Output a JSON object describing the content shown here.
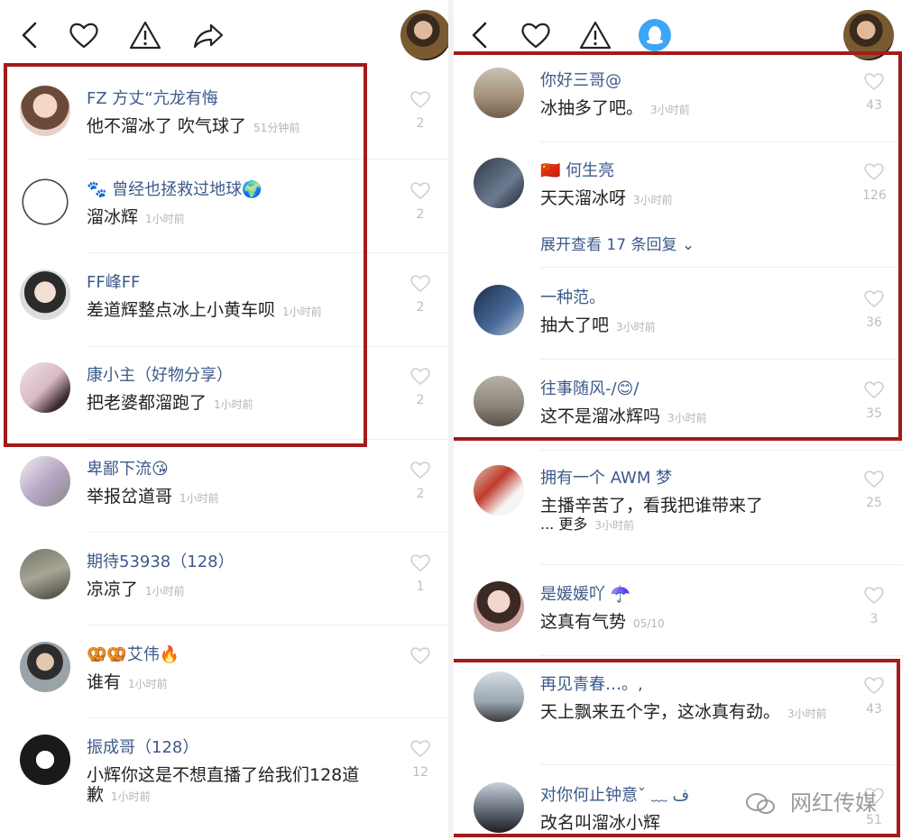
{
  "left": {
    "comments": [
      {
        "name": "FZ 方丈“亢龙有悔",
        "text": "他不溜冰了 吹气球了",
        "time": "51分钟前",
        "count": "2"
      },
      {
        "name": "🐾 曾经也拯救过地球🌍",
        "text": "溜冰辉",
        "time": "1小时前",
        "count": "2"
      },
      {
        "name": "FF峰FF",
        "text": "差道辉整点冰上小黄车呗",
        "time": "1小时前",
        "count": "2"
      },
      {
        "name": "康小主（好物分享）",
        "text": "把老婆都溜跑了",
        "time": "1小时前",
        "count": "2"
      },
      {
        "name": "卑鄙下流😘",
        "text": "举报岔道哥",
        "time": "1小时前",
        "count": "2"
      },
      {
        "name": "期待53938（128）",
        "text": "凉凉了",
        "time": "1小时前",
        "count": "1"
      },
      {
        "name": "🥨🥨艾伟🔥",
        "text": "谁有",
        "time": "1小时前",
        "count": ""
      },
      {
        "name": "振成哥（128）",
        "text": "小辉你这是不想直播了给我们128道",
        "text2": "歉",
        "time": "1小时前",
        "count": "12"
      }
    ]
  },
  "right": {
    "comments": [
      {
        "name": "你好三哥@",
        "text": "冰抽多了吧。",
        "time": "3小时前",
        "count": "43"
      },
      {
        "name": "🇨🇳 何生亮",
        "text": "天天溜冰呀",
        "time": "3小时前",
        "count": "126"
      },
      {
        "name": "一种范。",
        "text": "抽大了吧",
        "time": "3小时前",
        "count": "36"
      },
      {
        "name": "往事随风-/😊/",
        "text": "这不是溜冰辉吗",
        "time": "3小时前",
        "count": "35"
      },
      {
        "name": "拥有一个 AWM 梦",
        "text": "主播辛苦了，看我把谁带来了",
        "text2": "... 更多",
        "time": "3小时前",
        "count": "25"
      },
      {
        "name": "是媛媛吖 ☂️",
        "text": "这真有气势",
        "time": "05/10",
        "count": "3"
      },
      {
        "name": "再见青春…。,",
        "text": "天上飘来五个字，这冰真有劲。",
        "time": "3小时前",
        "count": "43"
      },
      {
        "name": "对你何止钟意ˇ  ﹏ ف",
        "text": "改名叫溜冰小辉",
        "time": "",
        "count": "51"
      }
    ],
    "expand_label": "展开查看 17 条回复 ⌄"
  },
  "watermark": "网红传媒",
  "colors": {
    "accent_name": "#3d5a8a",
    "highlight_box": "#a31b1b",
    "qq_badge": "#3aa6f5"
  }
}
